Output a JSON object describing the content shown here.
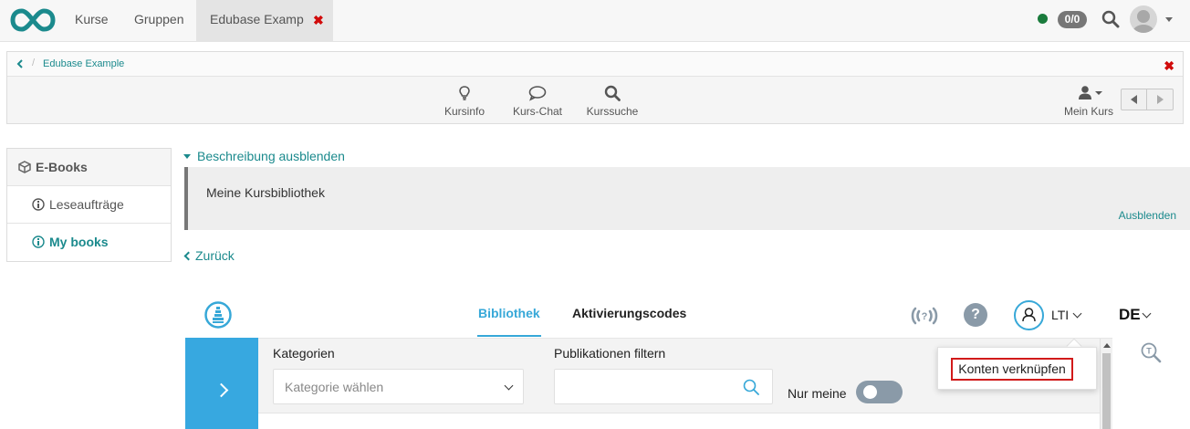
{
  "topnav": {
    "items": [
      {
        "label": "Kurse"
      },
      {
        "label": "Gruppen"
      }
    ],
    "active_tab": {
      "label": "Edubase Example"
    },
    "counter": "0/0",
    "colors": {
      "online": "#1a7b3c",
      "accent": "#1b8a8d",
      "close": "#d10b0b"
    }
  },
  "course": {
    "breadcrumb": "Edubase Example",
    "tools": [
      {
        "label": "Kursinfo",
        "icon": "lightbulb-icon"
      },
      {
        "label": "Kurs-Chat",
        "icon": "chat-bubble-icon"
      },
      {
        "label": "Kurssuche",
        "icon": "search-icon"
      }
    ],
    "my_course_label": "Mein Kurs"
  },
  "sidebar": {
    "items": [
      {
        "label": "E-Books",
        "icon": "cube-icon"
      },
      {
        "label": "Leseaufträge",
        "icon": "info-circle-icon"
      },
      {
        "label": "My books",
        "icon": "info-circle-icon",
        "active": true
      }
    ]
  },
  "description": {
    "toggle_label": "Beschreibung ausblenden",
    "text": "Meine Kursbibliothek",
    "hide_label": "Ausblenden"
  },
  "back_label": "Zurück",
  "edubase": {
    "tabs": [
      {
        "label": "Bibliothek",
        "active": true
      },
      {
        "label": "Aktivierungscodes"
      }
    ],
    "help_glyph": "?",
    "user_label": "LTI",
    "language": "DE",
    "filters": {
      "category_label": "Kategorien",
      "category_placeholder": "Kategorie wählen",
      "publication_label": "Publikationen filtern",
      "publication_value": "",
      "only_mine_label": "Nur meine",
      "only_mine_on": false
    },
    "dropdown": {
      "item": "Konten verknüpfen"
    },
    "colors": {
      "brand": "#37a8d8",
      "sidebar_button": "#37a8e0"
    }
  }
}
